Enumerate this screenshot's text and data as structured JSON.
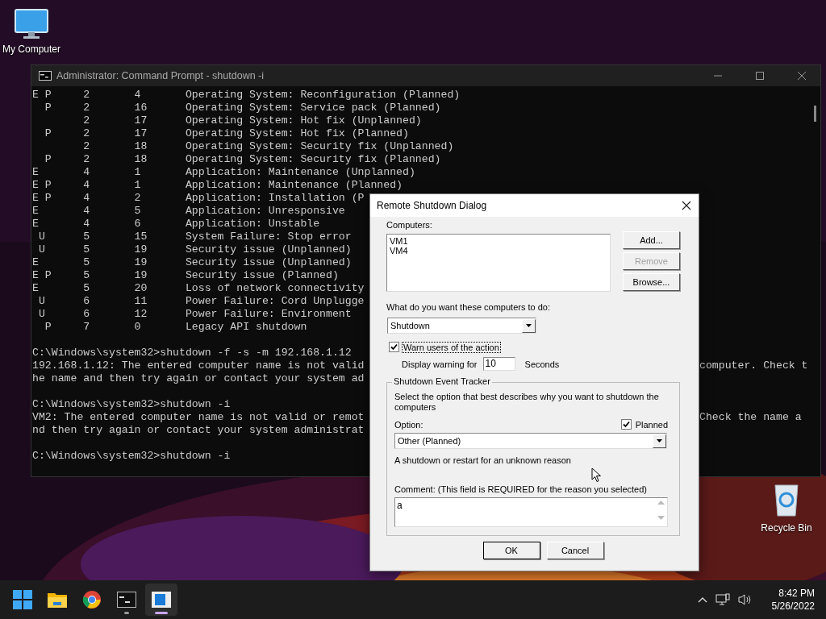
{
  "desktop_icons": [
    {
      "label": "My Computer",
      "kind": "computer"
    },
    {
      "label": "Recycle Bin",
      "kind": "recycle"
    }
  ],
  "console": {
    "title": "Administrator: Command Prompt - shutdown  -i",
    "lines": [
      {
        "text": "E P     2       4       Operating System: Reconfiguration (Planned)"
      },
      {
        "text": "  P     2       16      Operating System: Service pack (Planned)"
      },
      {
        "text": "        2       17      Operating System: Hot fix (Unplanned)"
      },
      {
        "text": "  P     2       17      Operating System: Hot fix (Planned)"
      },
      {
        "text": "        2       18      Operating System: Security fix (Unplanned)"
      },
      {
        "text": "  P     2       18      Operating System: Security fix (Planned)"
      },
      {
        "text": "E       4       1       Application: Maintenance (Unplanned)"
      },
      {
        "text": "E P     4       1       Application: Maintenance (Planned)"
      },
      {
        "text": "E P     4       2       Application: Installation (P"
      },
      {
        "text": "E       4       5       Application: Unresponsive"
      },
      {
        "text": "E       4       6       Application: Unstable"
      },
      {
        "text": " U      5       15      System Failure: Stop error"
      },
      {
        "text": " U      5       19      Security issue (Unplanned)"
      },
      {
        "text": "E       5       19      Security issue (Unplanned)"
      },
      {
        "text": "E P     5       19      Security issue (Planned)"
      },
      {
        "text": "E       5       20      Loss of network connectivity"
      },
      {
        "text": " U      6       11      Power Failure: Cord Unplugge"
      },
      {
        "text": " U      6       12      Power Failure: Environment"
      },
      {
        "text": "  P     7       0       Legacy API shutdown"
      },
      {
        "kind": "blank"
      },
      {
        "text": "C:\\Windows\\system32>shutdown -f -s -m 192.168.1.12"
      },
      {
        "text": "192.168.1.12: The entered computer name is not valid",
        "right": "computer. Check t"
      },
      {
        "text": "he name and then try again or contact your system ad"
      },
      {
        "kind": "blank"
      },
      {
        "text": "C:\\Windows\\system32>shutdown -i"
      },
      {
        "text": "VM2: The entered computer name is not valid or remot",
        "right": "Check the name a"
      },
      {
        "text": "nd then try again or contact your system administrat"
      },
      {
        "kind": "blank"
      },
      {
        "text": "C:\\Windows\\system32>shutdown -i"
      }
    ]
  },
  "dialog": {
    "title": "Remote Shutdown Dialog",
    "computers_label": "Computers:",
    "computers": [
      "VM1",
      "VM4"
    ],
    "side_buttons": [
      {
        "label": "Add...",
        "disabled": false
      },
      {
        "label": "Remove",
        "disabled": true
      },
      {
        "label": "Browse...",
        "disabled": false
      }
    ],
    "action_label": "What do you want these computers to do:",
    "action": "Shutdown",
    "warn": {
      "label": "Warn users of the action",
      "checked": true
    },
    "display_label": "Display warning for",
    "warning_seconds": "10",
    "seconds_label": "Seconds",
    "tracker": {
      "title": "Shutdown Event Tracker",
      "description": "Select the option that best describes why you want to shutdown the computers",
      "option_label": "Option:",
      "planned": {
        "label": "Planned",
        "checked": true
      },
      "option": "Other (Planned)",
      "option_description": "A shutdown or restart for an unknown reason",
      "comment_label": "Comment: (This field is REQUIRED for the reason you selected)",
      "comment": "a"
    },
    "buttons": [
      "OK",
      "Cancel"
    ]
  },
  "taskbar": {
    "apps": [
      {
        "kind": "start",
        "running": false,
        "selected": false
      },
      {
        "kind": "folder",
        "running": false,
        "selected": false
      },
      {
        "kind": "browser",
        "running": false,
        "selected": false
      },
      {
        "kind": "terminal",
        "running": true,
        "selected": false
      },
      {
        "kind": "dialog",
        "running": true,
        "selected": true
      }
    ],
    "time": "8:42 PM",
    "date": "5/26/2022"
  }
}
